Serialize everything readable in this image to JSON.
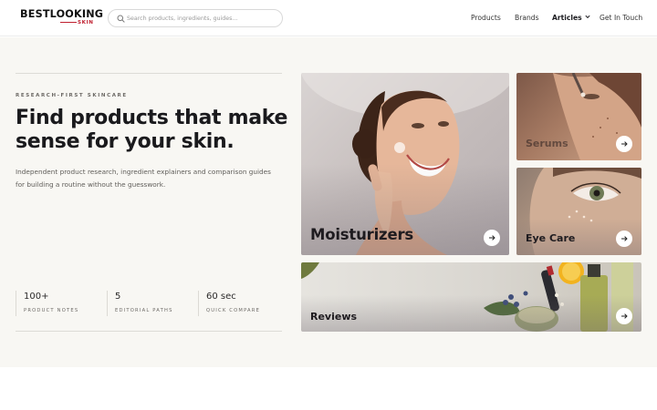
{
  "header": {
    "logo": {
      "main": "BESTLOOKING",
      "sub": "SKIN"
    },
    "search": {
      "placeholder": "Search products, ingredients, guides..."
    },
    "nav": {
      "products": "Products",
      "brands": "Brands",
      "articles": "Articles",
      "contact": "Get In Touch"
    }
  },
  "hero": {
    "eyebrow": "RESEARCH-FIRST SKINCARE",
    "headline_line1": "Find products that make",
    "headline_line2": "sense for your skin.",
    "subtext": "Independent product research, ingredient explainers and comparison guides for building a routine without the guesswork.",
    "stats": [
      {
        "value": "100+",
        "label": "PRODUCT NOTES"
      },
      {
        "value": "5",
        "label": "EDITORIAL PATHS"
      },
      {
        "value": "60 sec",
        "label": "QUICK COMPARE"
      }
    ]
  },
  "cards": {
    "moisturizers": "Moisturizers",
    "serums": "Serums",
    "eye_care": "Eye Care",
    "reviews": "Reviews"
  },
  "icons": {
    "search": "search-icon",
    "caret": "chevron-down-icon",
    "arrow": "arrow-right-icon"
  },
  "colors": {
    "brand_accent": "#bf1f2f",
    "hero_background": "#f8f7f3",
    "text_dark": "#1a1a1d"
  }
}
